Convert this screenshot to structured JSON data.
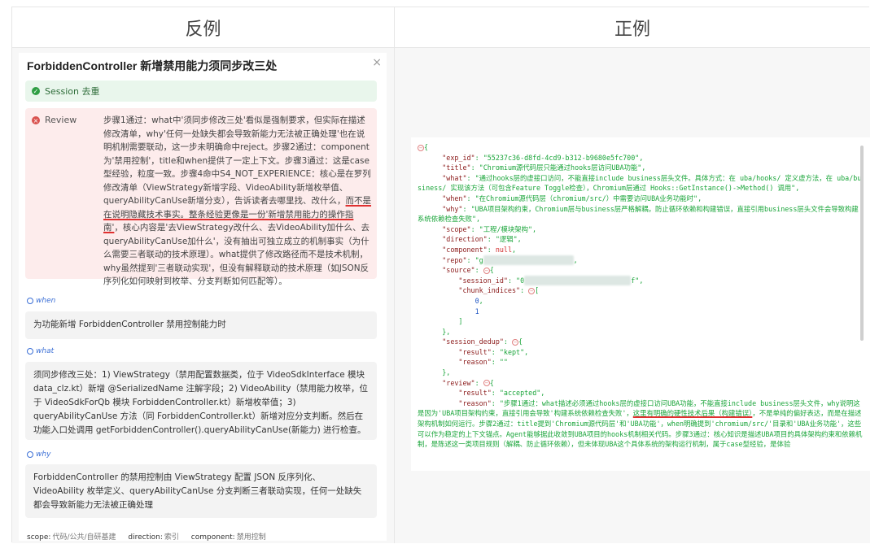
{
  "headers": {
    "left": "反例",
    "right": "正例"
  },
  "left": {
    "title": "ForbiddenController 新增禁用能力须同步改三处",
    "close": "×",
    "session": "Session 去重",
    "review_label": "Review",
    "review_text_1": "步骤1通过：what中'须同步修改三处'看似是强制要求，但实际在描述修改清单，why'任何一处缺失都会导致新能力无法被正确处理'也在说明机制需要联动，这一步未明确命中reject。步骤2通过：component为'禁用控制'，title和when提供了一定上下文。步骤3通过：这是case型经验，粒度一致。步骤4命中S4_NOT_EXPERIENCE：核心是在罗列修改清单（ViewStrategy新增字段、VideoAbility新增枚举值、queryAbilityCanUse新增分支），告诉读者去哪里找、改什么，",
    "review_text_ul": "而不是在说明隐藏技术事实。整条经验更像是一份'新增禁用能力的操作指南'",
    "review_text_2": "，核心内容是'去ViewStrategy改什么、去VideoAbility加什么、去queryAbilityCanUse加什么'，没有抽出可独立成立的机制事实（为什么需要三者联动的技术原理）。what提供了修改路径而不是技术机制，why虽然提到'三者联动实现'，但没有解释联动的技术原理（如JSON反序列化如何映射到枚举、分支判断如何匹配等）。",
    "when_label": "when",
    "when_text": "为功能新增 ForbiddenController 禁用控制能力时",
    "what_label": "what",
    "what_text": "须同步修改三处：1) ViewStrategy（禁用配置数据类，位于 VideoSdkInterface 模块 data_clz.kt）新增 @SerializedName 注解字段；2) VideoAbility（禁用能力枚举，位于 VideoSdkForQb 模块 ForbiddenController.kt）新增枚举值；3) queryAbilityCanUse 方法（同 ForbiddenController.kt）新增对应分支判断。然后在功能入口处调用 getForbiddenController().queryAbilityCanUse(新能力) 进行检查。",
    "why_label": "why",
    "why_text": "ForbiddenController 的禁用控制由 ViewStrategy 配置 JSON 反序列化、VideoAbility 枚举定义、queryAbilityCanUse 分支判断三者联动实现，任何一处缺失都会导致新能力无法被正确处理",
    "footer": {
      "scope_k": "scope:",
      "scope_v": "代码/公共/自研基建",
      "direction_k": "direction:",
      "direction_v": "索引",
      "component_k": "component:",
      "component_v": "禁用控制"
    }
  },
  "right": {
    "exp_id_k": "\"exp_id\"",
    "exp_id_v": "\"55237c36-d8fd-4cd9-b312-b9680e5fc700\"",
    "title_k": "\"title\"",
    "title_v": "\"Chromium源代码层只能通过hooks层访问UBA功能\"",
    "what_k": "\"what\"",
    "what_v": "\"通过hooks层的虚接口访问，不能直接include business层头文件。具体方式：在 uba/hooks/ 定义虚方法，在 uba/business/ 实现该方法（可包含Feature Toggle检查），Chromium层通过 Hooks::GetInstance()->Method() 调用\"",
    "when_k": "\"when\"",
    "when_v": "\"在Chromium源代码层（chromium/src/）中需要访问UBA业务功能时\"",
    "why_k": "\"why\"",
    "why_v": "\"UBA项目架构约束，Chromium层与business层严格解耦，防止循环依赖和构建错误，直接引用business层头文件会导致构建系统依赖检查失败\"",
    "scope_k": "\"scope\"",
    "scope_v": "\"工程/模块架构\"",
    "direction_k": "\"direction\"",
    "direction_v": "\"逻辑\"",
    "component_k": "\"component\"",
    "component_v": "null",
    "repo_k": "\"repo\"",
    "repo_v": "\"g",
    "source_k": "\"source\"",
    "session_id_k": "\"session_id\"",
    "session_id_v1": "\"0",
    "session_id_v2": "f\"",
    "chunk_k": "\"chunk_indices\"",
    "chunk_0": "0",
    "chunk_1": "1",
    "dedup_k": "\"session_dedup\"",
    "result_k": "\"result\"",
    "dedup_result_v": "\"kept\"",
    "reason_k": "\"reason\"",
    "dedup_reason_v": "\"\"",
    "review_k": "\"review\"",
    "review_result_v": "\"accepted\"",
    "review_reason_v1": "\"步骤1通过：what描述必须通过hooks层的虚接口访问UBA功能，不能直接include business层头文件，why说明这是因为'UBA项目架构约束，直接引用会导致'构建系统依赖检查失败'，",
    "review_reason_ul": "这里有明确的硬性技术后果（构建错误）",
    "review_reason_v2": "，不是单纯的偏好表达，而是在描述架构机制如何运行。步骤2通过：title提到'Chromium源代码层'和'UBA功能'，when明确提到'chromium/src/'目录和'UBA业务功能'，这些可以作为稳定的上下文锚点。Agent能够据此收敛到UBA项目的hooks机制相关代码。步骤3通过：核心知识是描述UBA项目的具体架构约束和依赖机制，是陈述这一类项目规则（解耦、防止循环依赖），但未体现UBA这个具体系统的架构运行机制，属于case型经验，是体验"
  }
}
